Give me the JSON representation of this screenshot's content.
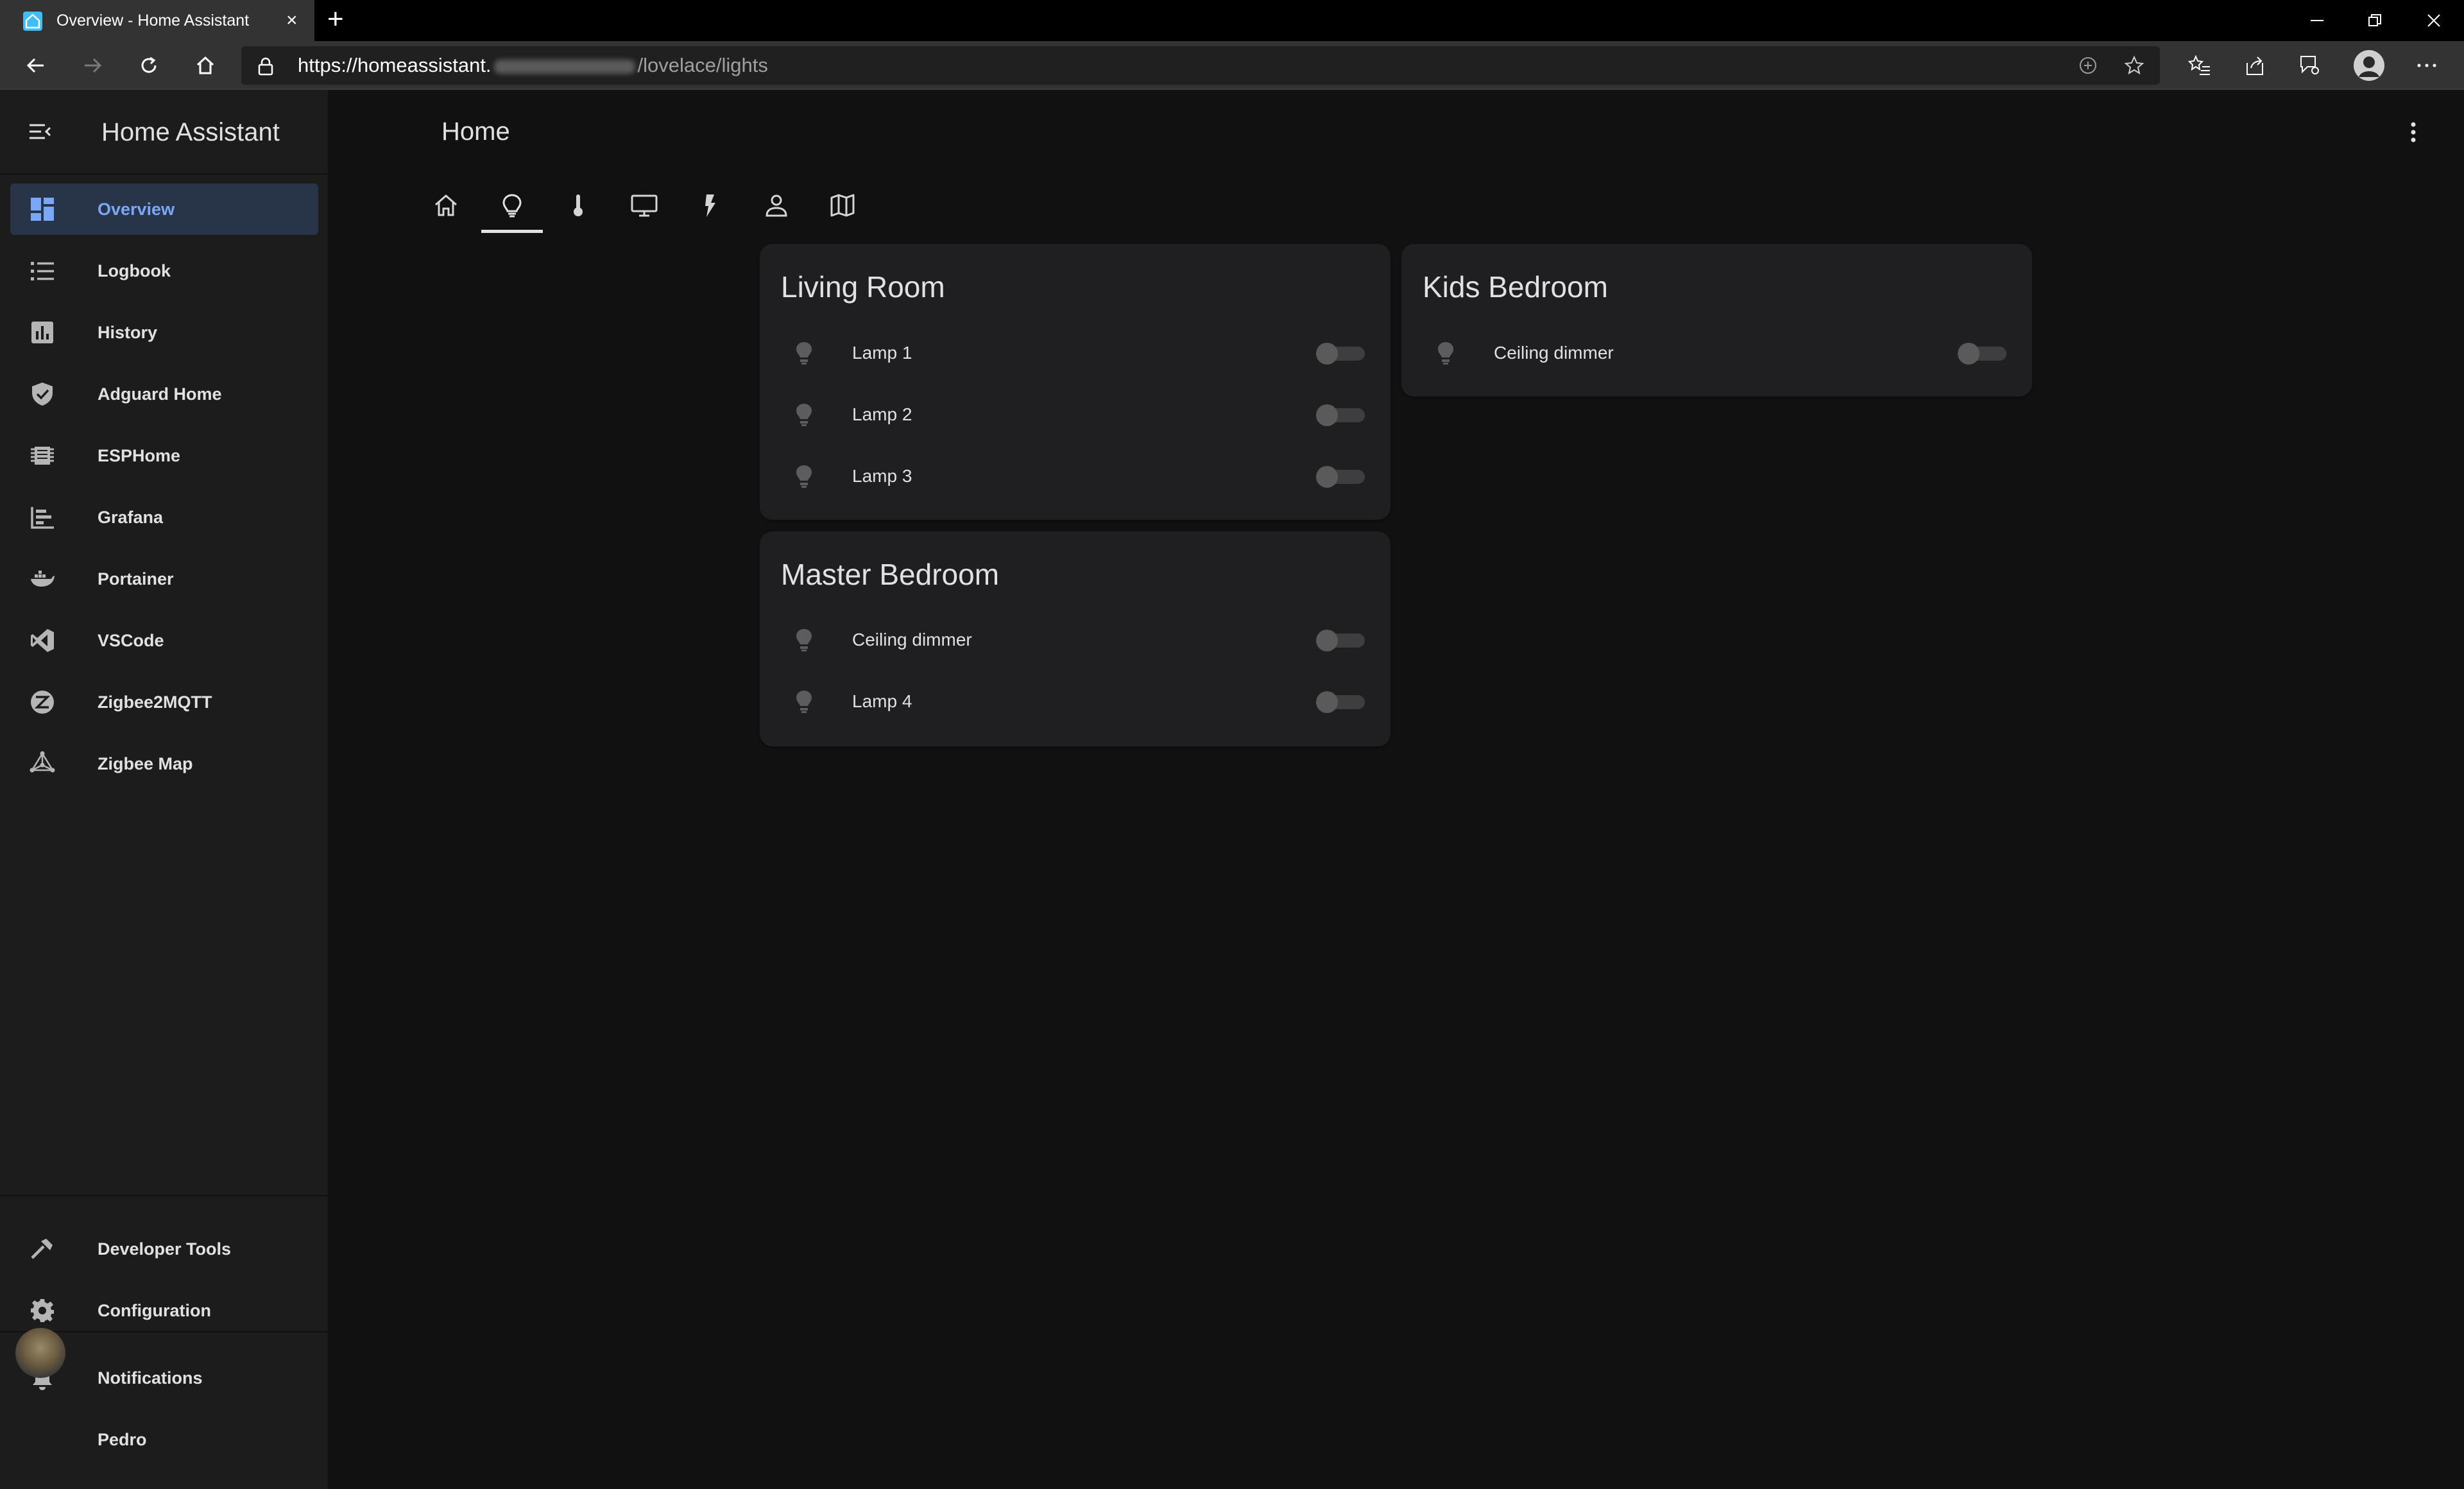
{
  "browser": {
    "tab_title": "Overview - Home Assistant",
    "tab_close": "×",
    "new_tab": "+",
    "url_host": "https://homeassistant.",
    "url_path": "/lovelace/lights"
  },
  "sidebar": {
    "title": "Home Assistant",
    "items": [
      {
        "label": "Overview",
        "icon": "dashboard-icon",
        "active": true
      },
      {
        "label": "Logbook",
        "icon": "list-icon"
      },
      {
        "label": "History",
        "icon": "chart-box-icon"
      },
      {
        "label": "Adguard Home",
        "icon": "shield-check-icon"
      },
      {
        "label": "ESPHome",
        "icon": "chip-icon"
      },
      {
        "label": "Grafana",
        "icon": "chart-timeline-icon"
      },
      {
        "label": "Portainer",
        "icon": "docker-icon"
      },
      {
        "label": "VSCode",
        "icon": "vscode-icon"
      },
      {
        "label": "Zigbee2MQTT",
        "icon": "zigbee-icon"
      },
      {
        "label": "Zigbee Map",
        "icon": "graph-icon"
      }
    ],
    "developer_tools": "Developer Tools",
    "configuration": "Configuration",
    "notifications": "Notifications",
    "user": "Pedro"
  },
  "main": {
    "title": "Home",
    "view_tabs": [
      "home-icon",
      "lightbulb-icon",
      "thermometer-icon",
      "monitor-icon",
      "flash-icon",
      "person-icon",
      "map-icon"
    ],
    "active_view": "lightbulb-icon"
  },
  "cards": {
    "living_room": {
      "title": "Living Room",
      "entities": [
        {
          "name": "Lamp 1",
          "state": "off"
        },
        {
          "name": "Lamp 2",
          "state": "off"
        },
        {
          "name": "Lamp 3",
          "state": "off"
        }
      ]
    },
    "master_bedroom": {
      "title": "Master Bedroom",
      "entities": [
        {
          "name": "Ceiling dimmer",
          "state": "off"
        },
        {
          "name": "Lamp 4",
          "state": "off"
        }
      ]
    },
    "kids_bedroom": {
      "title": "Kids Bedroom",
      "entities": [
        {
          "name": "Ceiling dimmer",
          "state": "off"
        }
      ]
    }
  },
  "colors": {
    "accent": "#7aa8f7",
    "active_bg": "#283549",
    "sidebar_bg": "#1c1c1c",
    "card_bg": "#1f1f21",
    "page_bg": "#111111"
  }
}
